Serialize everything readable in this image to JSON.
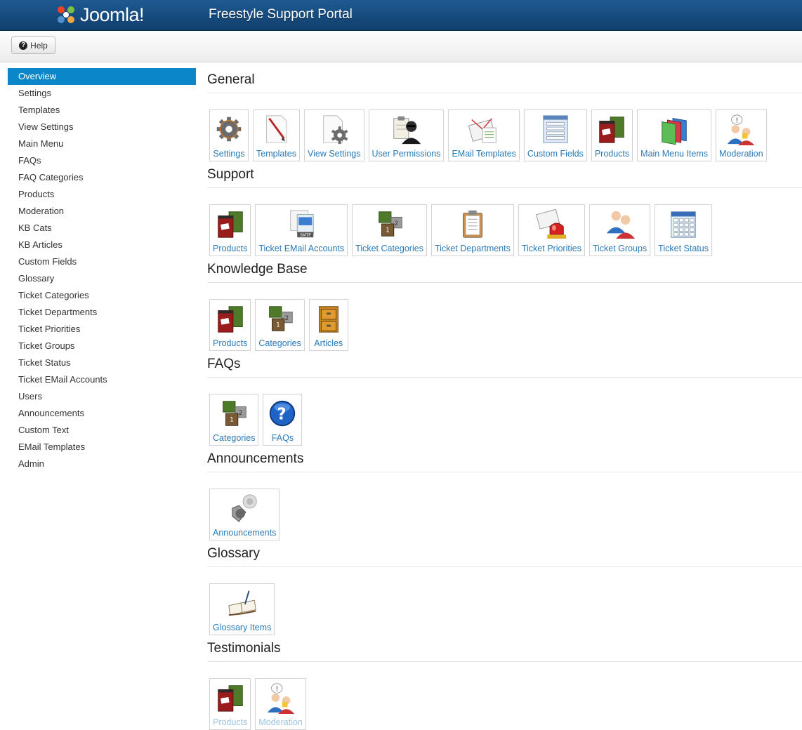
{
  "header": {
    "logo_text": "Joomla!",
    "portal_title": "Freestyle Support Portal"
  },
  "toolbar": {
    "help_label": "Help",
    "help_icon": "question-circle-icon"
  },
  "sidebar": {
    "items": [
      {
        "label": "Overview",
        "active": true
      },
      {
        "label": "Settings"
      },
      {
        "label": "Templates"
      },
      {
        "label": "View Settings"
      },
      {
        "label": "Main Menu"
      },
      {
        "label": "FAQs"
      },
      {
        "label": "FAQ Categories"
      },
      {
        "label": "Products"
      },
      {
        "label": "Moderation"
      },
      {
        "label": "KB Cats"
      },
      {
        "label": "KB Articles"
      },
      {
        "label": "Custom Fields"
      },
      {
        "label": "Glossary"
      },
      {
        "label": "Ticket Categories"
      },
      {
        "label": "Ticket Departments"
      },
      {
        "label": "Ticket Priorities"
      },
      {
        "label": "Ticket Groups"
      },
      {
        "label": "Ticket Status"
      },
      {
        "label": "Ticket EMail Accounts"
      },
      {
        "label": "Users"
      },
      {
        "label": "Announcements"
      },
      {
        "label": "Custom Text"
      },
      {
        "label": "EMail Templates"
      },
      {
        "label": "Admin"
      }
    ]
  },
  "sections": [
    {
      "title": "General",
      "tiles": [
        {
          "label": "Settings",
          "icon": "gear-icon"
        },
        {
          "label": "Templates",
          "icon": "template-brush-icon"
        },
        {
          "label": "View Settings",
          "icon": "document-gear-icon"
        },
        {
          "label": "User Permissions",
          "icon": "user-clipboard-icon"
        },
        {
          "label": "EMail Templates",
          "icon": "email-envelope-icon"
        },
        {
          "label": "Custom Fields",
          "icon": "form-fields-icon"
        },
        {
          "label": "Products",
          "icon": "product-boxes-icon"
        },
        {
          "label": "Main Menu Items",
          "icon": "menu-panels-icon"
        },
        {
          "label": "Moderation",
          "icon": "moderation-users-icon"
        }
      ]
    },
    {
      "title": "Support",
      "tiles": [
        {
          "label": "Products",
          "icon": "product-boxes-icon"
        },
        {
          "label": "Ticket EMail Accounts",
          "icon": "smtp-server-icon"
        },
        {
          "label": "Ticket Categories",
          "icon": "category-boxes-icon"
        },
        {
          "label": "Ticket Departments",
          "icon": "clipboard-icon"
        },
        {
          "label": "Ticket Priorities",
          "icon": "alarm-light-icon"
        },
        {
          "label": "Ticket Groups",
          "icon": "user-group-icon"
        },
        {
          "label": "Ticket Status",
          "icon": "status-calendar-icon"
        }
      ]
    },
    {
      "title": "Knowledge Base",
      "tiles": [
        {
          "label": "Products",
          "icon": "product-boxes-icon"
        },
        {
          "label": "Categories",
          "icon": "category-boxes-icon"
        },
        {
          "label": "Articles",
          "icon": "filing-cabinet-icon"
        }
      ]
    },
    {
      "title": "FAQs",
      "tiles": [
        {
          "label": "Categories",
          "icon": "category-boxes-icon"
        },
        {
          "label": "FAQs",
          "icon": "help-question-icon"
        }
      ]
    },
    {
      "title": "Announcements",
      "tiles": [
        {
          "label": "Announcements",
          "icon": "speaker-icon"
        }
      ]
    },
    {
      "title": "Glossary",
      "tiles": [
        {
          "label": "Glossary Items",
          "icon": "open-book-icon"
        }
      ]
    },
    {
      "title": "Testimonials",
      "tiles": [
        {
          "label": "Products",
          "icon": "product-boxes-icon"
        },
        {
          "label": "Moderation",
          "icon": "moderation-users-icon"
        }
      ]
    }
  ]
}
